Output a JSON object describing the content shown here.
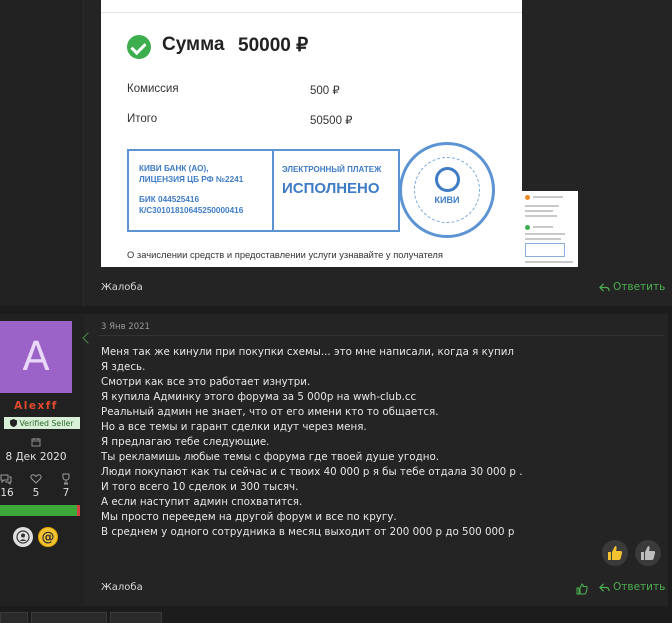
{
  "receipt": {
    "sum_label": "Сумма",
    "sum_value": "50000 ₽",
    "commission_label": "Комиссия",
    "commission_value": "500 ₽",
    "total_label": "Итого",
    "total_value": "50500 ₽",
    "bank_lines": [
      "КИВИ БАНК (АО),",
      "ЛИЦЕНЗИЯ ЦБ РФ №2241"
    ],
    "bik_lines": [
      "БИК 044525416",
      "К/С30101810645250000416"
    ],
    "status_small": "ЭЛЕКТРОННЫЙ ПЛАТЕЖ",
    "status_big": "ИСПОЛНЕНО",
    "stamp_text": "КИВИ",
    "footer": "О зачислении средств и предоставлении услуги узнавайте у получателя"
  },
  "top_post": {
    "complaint_label": "Жалоба",
    "reply_label": "Ответить"
  },
  "user": {
    "avatar_letter": "A",
    "name": "Alexff",
    "badge": "Verified Seller",
    "joined": "8 Дек 2020",
    "stats": [
      "16",
      "5",
      "7"
    ]
  },
  "post": {
    "date": "3 Янв 2021",
    "lines": [
      "Меня так же кинули при покупки схемы... это мне написали, когда я купил",
      "Я здесь.",
      "Смотри как все это работает изнутри.",
      "Я купила Админку этого форума за 5 000р на wwh-club.cc",
      "Реальный админ не знает, что от его имени кто то общается.",
      "Но а все темы и гарант сделки идут через меня.",
      "Я предлагаю тебе следующие.",
      "Ты рекламишь любые темы с форума где твоей душе угодно.",
      "Люди покупают как ты сейчас и с твоих 40 000 р я бы тебе отдала 30 000 р .",
      "И того всего 10 сделок и 300 тысяч.",
      "А если наступит админ спохватится.",
      "Мы просто переедем на другой форум и все по кругу.",
      "В среднем у одного сотрудника в месяц выходит от 200 000 р до 500 000 р"
    ],
    "complaint_label": "Жалоба",
    "reply_label": "Ответить"
  },
  "colors": {
    "accent_green": "#4caf50",
    "username_red": "#e24a2c",
    "avatar_purple": "#9b62c8",
    "qiwi_blue": "#3f7cc6"
  }
}
